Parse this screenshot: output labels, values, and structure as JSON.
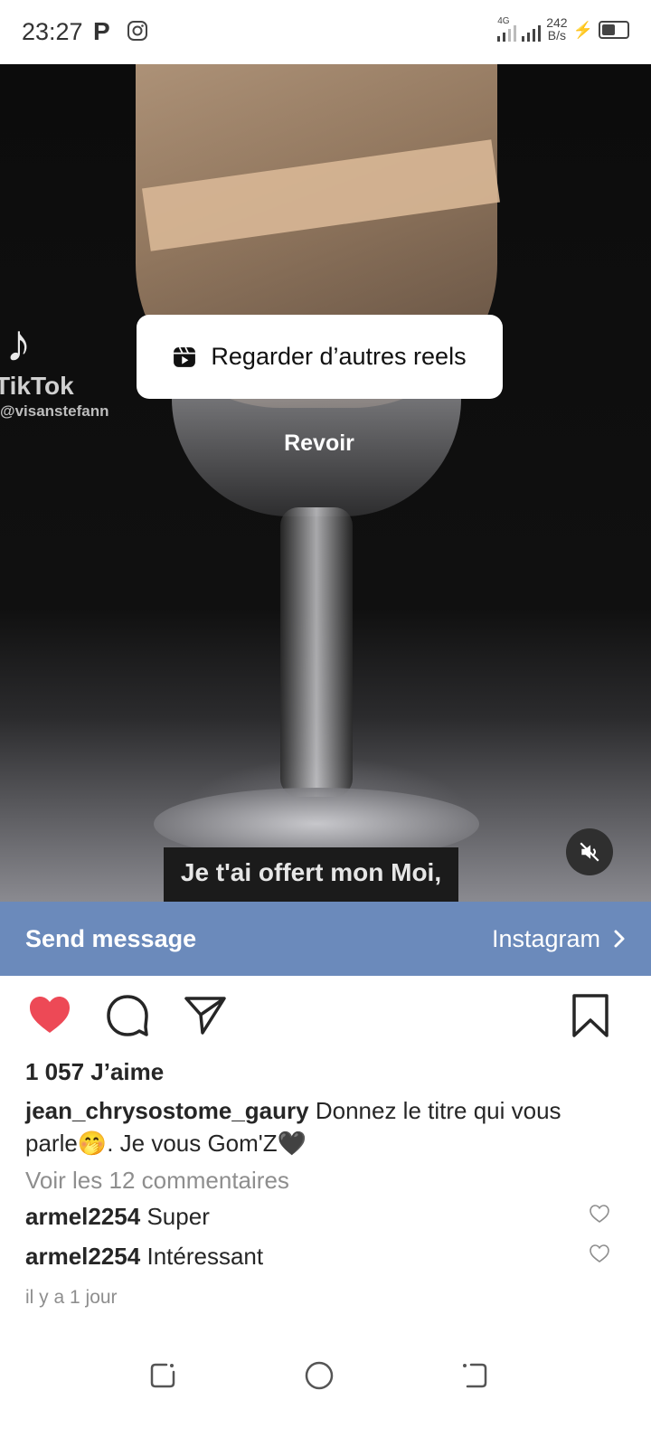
{
  "status_bar": {
    "time": "23:27",
    "parking_icon": "P",
    "network": "4G",
    "speed_value": "242",
    "speed_unit": "B/s"
  },
  "video": {
    "watermark_app": "TikTok",
    "watermark_handle": "@visanstefann",
    "more_reels_label": "Regarder d’autres reels",
    "replay_label": "Revoir",
    "subtitle": "Je t'ai offert mon Moi, J'ai vidé cet armoire"
  },
  "send_bar": {
    "send_label": "Send message",
    "link_label": "Instagram"
  },
  "post": {
    "likes": "1 057 J’aime",
    "author": "jean_chrysostome_gaury",
    "caption": "Donnez le titre qui vous parle🤭. Je vous Gom'Z🖤",
    "view_comments": "Voir les 12 commentaires",
    "comments": [
      {
        "user": "armel2254",
        "text": "Super"
      },
      {
        "user": "armel2254",
        "text": "Intéressant"
      }
    ],
    "time_ago": "il y a 1 jour"
  },
  "colors": {
    "send_bar": "#6b8abb",
    "like_red": "#ed4956"
  }
}
